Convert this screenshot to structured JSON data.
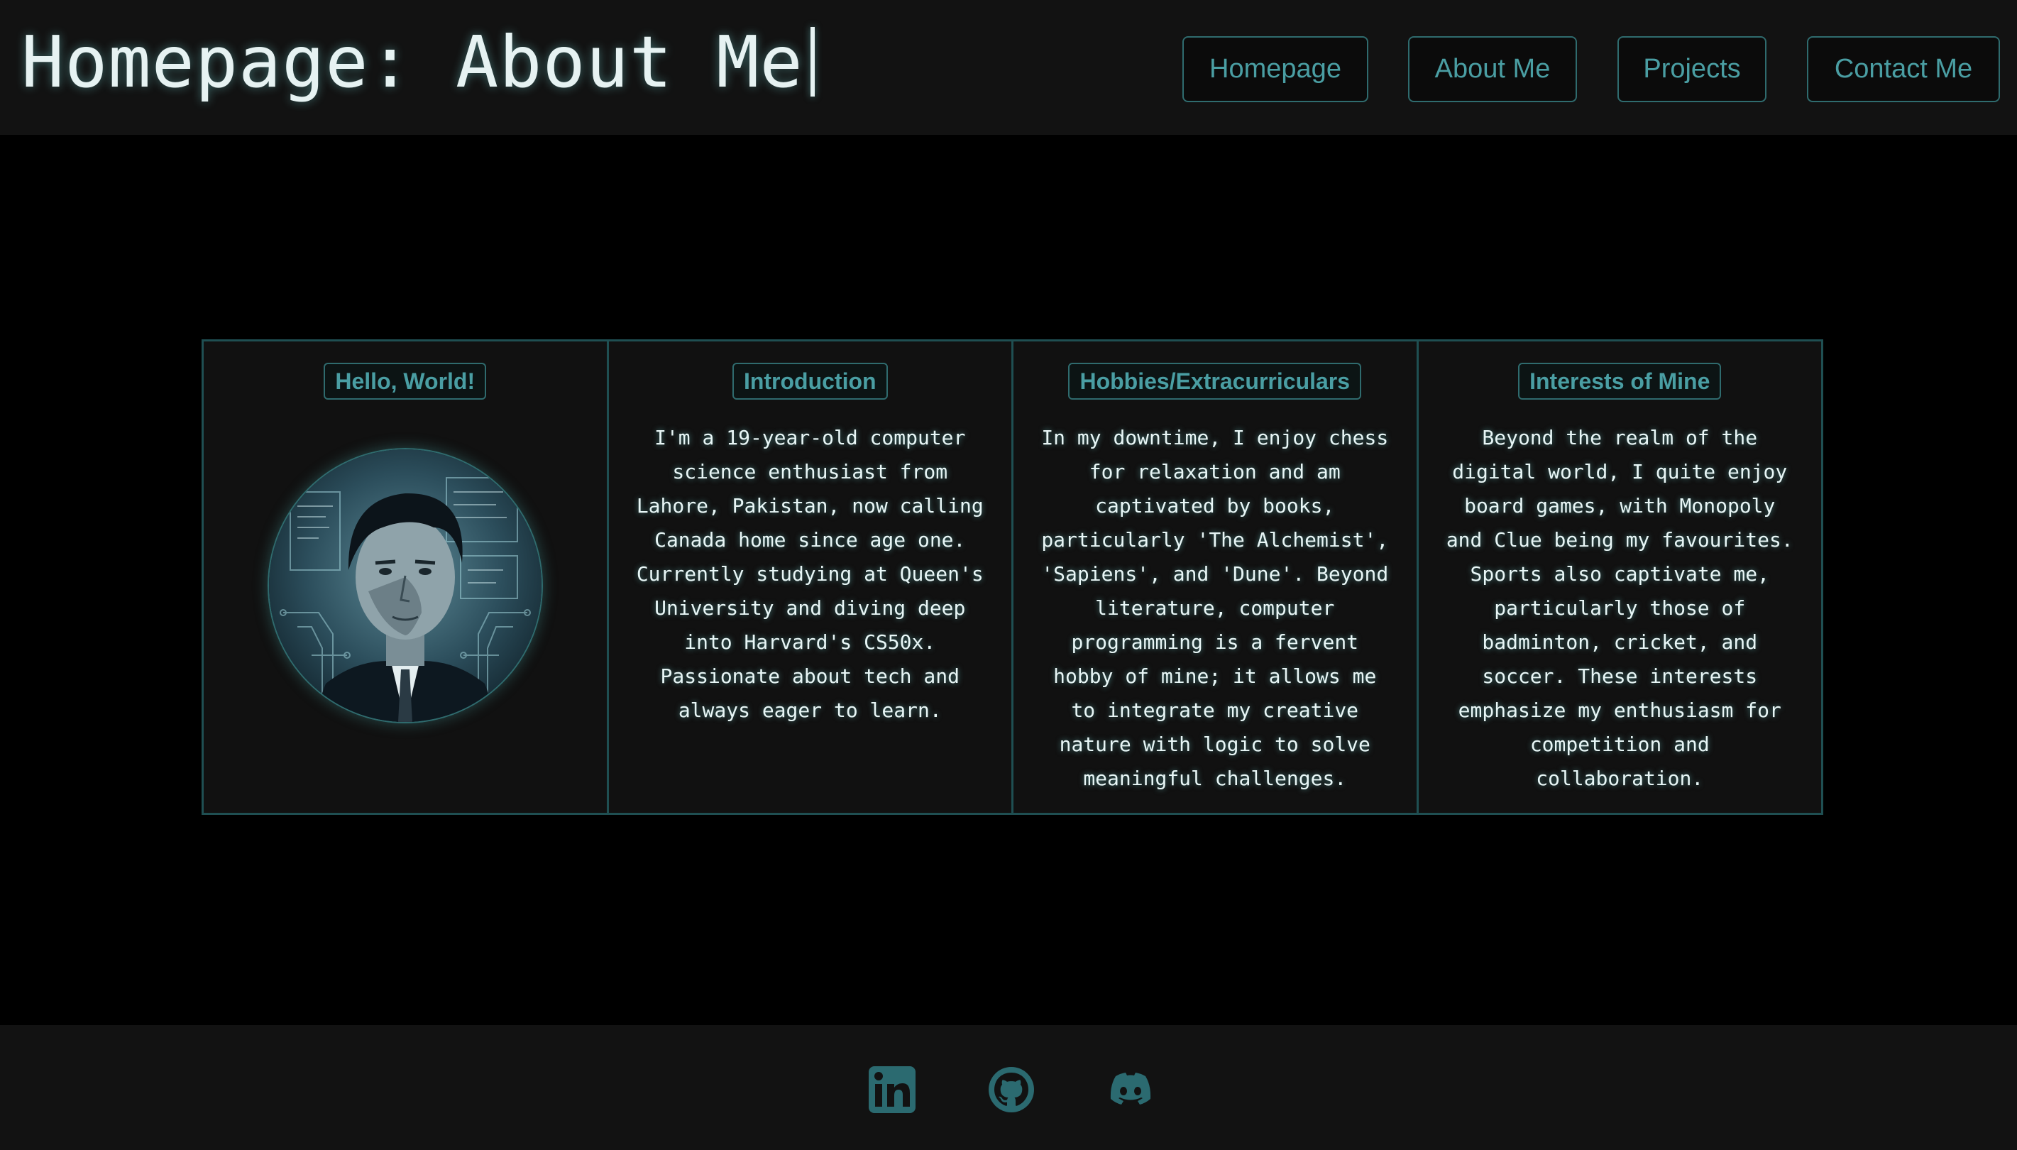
{
  "header": {
    "title": "Homepage: About Me"
  },
  "nav": {
    "homepage": "Homepage",
    "about": "About Me",
    "projects": "Projects",
    "contact": "Contact Me"
  },
  "cards": [
    {
      "title": "Hello, World!"
    },
    {
      "title": "Introduction",
      "text": "I'm a 19-year-old computer science enthusiast from Lahore, Pakistan, now calling Canada home since age one. Currently studying at Queen's University and diving deep into Harvard's CS50x. Passionate about tech and always eager to learn."
    },
    {
      "title": "Hobbies/Extracurriculars",
      "text": "In my downtime, I enjoy chess for relaxation and am captivated by books, particularly 'The Alchemist', 'Sapiens', and 'Dune'. Beyond literature, computer programming is a fervent hobby of mine; it allows me to integrate my creative nature with logic to solve meaningful challenges."
    },
    {
      "title": "Interests of Mine",
      "text": "Beyond the realm of the digital world, I quite enjoy board games, with Monopoly and Clue being my favourites. Sports also captivate me, particularly those of badminton, cricket, and soccer. These interests emphasize my enthusiasm for competition and collaboration."
    }
  ],
  "footer": {
    "icons": [
      "linkedin-icon",
      "github-icon",
      "discord-icon"
    ]
  },
  "colors": {
    "accent": "#4a9ea3",
    "border": "#2f6b6e",
    "background": "#000000",
    "panel": "#121212"
  }
}
